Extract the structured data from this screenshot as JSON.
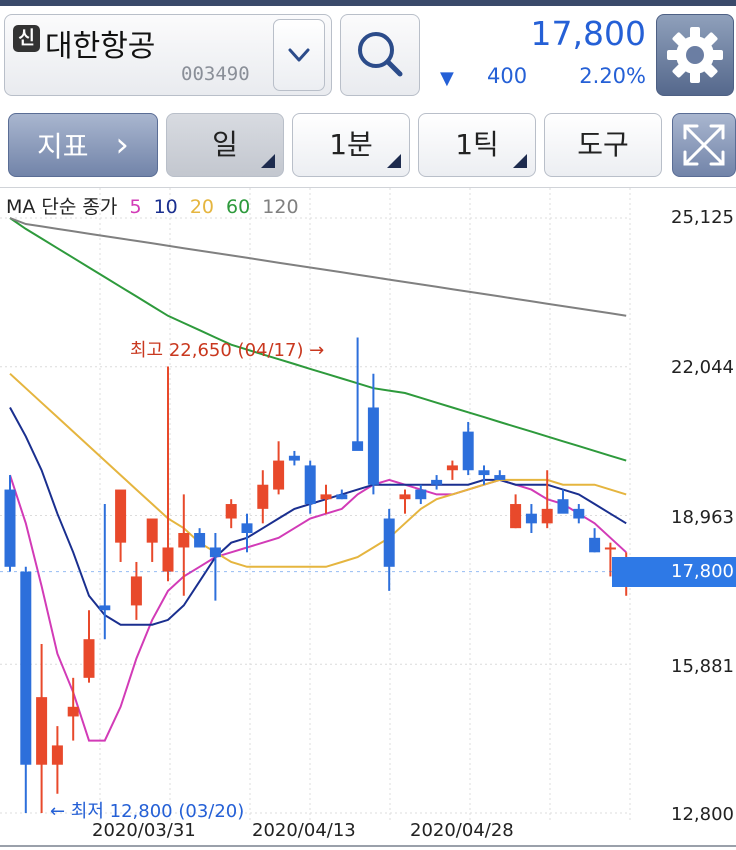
{
  "header": {
    "shin_badge": "신",
    "stock_name": "대한항공",
    "stock_code": "003490",
    "price": "17,800",
    "change_arrow": "▼",
    "change_value": "400",
    "change_pct": "2.20%"
  },
  "toolbar": {
    "indicator_label": "지표",
    "indicator_arrow": "›",
    "period_day": "일",
    "period_1min": "1분",
    "period_1tick": "1틱",
    "tools_label": "도구"
  },
  "legend": {
    "prefix": "MA 단순 종가",
    "ma": [
      {
        "label": "5",
        "color": "#d23bb7"
      },
      {
        "label": "10",
        "color": "#1a2f8f"
      },
      {
        "label": "20",
        "color": "#e5b53f"
      },
      {
        "label": "60",
        "color": "#2e9a3c"
      },
      {
        "label": "120",
        "color": "#808080"
      }
    ]
  },
  "price_axis": [
    "25,125",
    "22,044",
    "18,963",
    "15,881",
    "12,800"
  ],
  "current_tag": "17,800",
  "x_axis": [
    "2020/03/31",
    "2020/04/13",
    "2020/04/28"
  ],
  "annotations": {
    "high": "최고 22,650 (04/17) →",
    "low": "← 최저 12,800 (03/20)"
  },
  "colors": {
    "up": "#e8492b",
    "down": "#2d6fdb"
  },
  "chart_data": {
    "type": "candlestick",
    "ylim": [
      12800,
      25125
    ],
    "candles": [
      {
        "o": 19500,
        "h": 19800,
        "l": 17800,
        "c": 17900
      },
      {
        "o": 17800,
        "h": 17900,
        "l": 12800,
        "c": 13800
      },
      {
        "o": 13800,
        "h": 16300,
        "l": 12800,
        "c": 15200
      },
      {
        "o": 13800,
        "h": 14600,
        "l": 13200,
        "c": 14200
      },
      {
        "o": 14800,
        "h": 15600,
        "l": 14300,
        "c": 15000
      },
      {
        "o": 15600,
        "h": 17000,
        "l": 15500,
        "c": 16400
      },
      {
        "o": 17100,
        "h": 19200,
        "l": 16400,
        "c": 17000
      },
      {
        "o": 18400,
        "h": 19200,
        "l": 18000,
        "c": 19500
      },
      {
        "o": 17100,
        "h": 18000,
        "l": 16800,
        "c": 17700
      },
      {
        "o": 18400,
        "h": 18800,
        "l": 18000,
        "c": 18900
      },
      {
        "o": 17800,
        "h": 22050,
        "l": 17600,
        "c": 18300
      },
      {
        "o": 18300,
        "h": 19400,
        "l": 17300,
        "c": 18600
      },
      {
        "o": 18600,
        "h": 18700,
        "l": 18300,
        "c": 18300
      },
      {
        "o": 18300,
        "h": 18600,
        "l": 17200,
        "c": 18100
      },
      {
        "o": 18900,
        "h": 19300,
        "l": 18700,
        "c": 19200
      },
      {
        "o": 18800,
        "h": 19000,
        "l": 18200,
        "c": 18600
      },
      {
        "o": 19100,
        "h": 19900,
        "l": 18800,
        "c": 19600
      },
      {
        "o": 19500,
        "h": 20500,
        "l": 19400,
        "c": 20100
      },
      {
        "o": 20200,
        "h": 20300,
        "l": 20000,
        "c": 20100
      },
      {
        "o": 20000,
        "h": 20100,
        "l": 19000,
        "c": 19200
      },
      {
        "o": 19300,
        "h": 19600,
        "l": 19000,
        "c": 19400
      },
      {
        "o": 19400,
        "h": 19500,
        "l": 19300,
        "c": 19300
      },
      {
        "o": 20500,
        "h": 22650,
        "l": 20400,
        "c": 20300
      },
      {
        "o": 21200,
        "h": 21900,
        "l": 19400,
        "c": 19600
      },
      {
        "o": 18900,
        "h": 19100,
        "l": 17400,
        "c": 17900
      },
      {
        "o": 19300,
        "h": 19500,
        "l": 19000,
        "c": 19400
      },
      {
        "o": 19500,
        "h": 19600,
        "l": 19200,
        "c": 19300
      },
      {
        "o": 19700,
        "h": 19800,
        "l": 19500,
        "c": 19600
      },
      {
        "o": 19900,
        "h": 20100,
        "l": 19700,
        "c": 20000
      },
      {
        "o": 20700,
        "h": 20900,
        "l": 19800,
        "c": 19900
      },
      {
        "o": 19900,
        "h": 20000,
        "l": 19600,
        "c": 19800
      },
      {
        "o": 19800,
        "h": 19900,
        "l": 19700,
        "c": 19700
      },
      {
        "o": 18700,
        "h": 19400,
        "l": 18700,
        "c": 19200
      },
      {
        "o": 19000,
        "h": 19200,
        "l": 18600,
        "c": 18800
      },
      {
        "o": 18800,
        "h": 19900,
        "l": 18700,
        "c": 19100
      },
      {
        "o": 19300,
        "h": 19500,
        "l": 19100,
        "c": 19000
      },
      {
        "o": 19100,
        "h": 19200,
        "l": 18800,
        "c": 18900
      },
      {
        "o": 18500,
        "h": 18700,
        "l": 18200,
        "c": 18200
      },
      {
        "o": 18300,
        "h": 18400,
        "l": 17700,
        "c": 18300
      },
      {
        "o": 17600,
        "h": 18200,
        "l": 17300,
        "c": 17800
      }
    ],
    "ma_lines": [
      {
        "name": "5",
        "color": "#d23bb7",
        "values": [
          19800,
          18800,
          17500,
          16100,
          15300,
          14300,
          14300,
          15000,
          16000,
          16800,
          17400,
          17700,
          17900,
          18100,
          18200,
          18300,
          18400,
          18500,
          18700,
          18900,
          19000,
          19100,
          19400,
          19600,
          19700,
          19600,
          19500,
          19400,
          19400,
          19500,
          19600,
          19700,
          19600,
          19500,
          19300,
          19200,
          19000,
          18800,
          18500,
          18200
        ]
      },
      {
        "name": "10",
        "color": "#1a2f8f",
        "values": [
          21200,
          20600,
          19900,
          19000,
          18200,
          17300,
          16900,
          16700,
          16700,
          16700,
          16800,
          17100,
          17600,
          18100,
          18400,
          18500,
          18700,
          18900,
          19100,
          19200,
          19300,
          19400,
          19500,
          19600,
          19600,
          19600,
          19600,
          19600,
          19600,
          19600,
          19700,
          19700,
          19600,
          19600,
          19600,
          19500,
          19400,
          19200,
          19000,
          18800
        ]
      },
      {
        "name": "20",
        "color": "#e5b53f",
        "values": [
          21900,
          21600,
          21300,
          21000,
          20700,
          20400,
          20100,
          19800,
          19500,
          19200,
          18900,
          18700,
          18400,
          18200,
          18000,
          17900,
          17900,
          17900,
          17900,
          17900,
          17900,
          18000,
          18100,
          18300,
          18500,
          18800,
          19100,
          19300,
          19400,
          19500,
          19600,
          19700,
          19700,
          19700,
          19700,
          19600,
          19600,
          19600,
          19500,
          19400
        ]
      },
      {
        "name": "60",
        "color": "#2e9a3c",
        "values": [
          25125,
          24900,
          24700,
          24500,
          24300,
          24100,
          23900,
          23700,
          23500,
          23300,
          23100,
          22950,
          22800,
          22650,
          22500,
          22400,
          22300,
          22200,
          22100,
          22000,
          21900,
          21800,
          21700,
          21600,
          21550,
          21500,
          21400,
          21300,
          21200,
          21100,
          21000,
          20900,
          20800,
          20700,
          20600,
          20500,
          20400,
          20300,
          20200,
          20100
        ]
      },
      {
        "name": "120",
        "color": "#808080",
        "values": [
          25125,
          25000,
          24950,
          24900,
          24850,
          24800,
          24750,
          24700,
          24650,
          24600,
          24550,
          24500,
          24450,
          24400,
          24350,
          24300,
          24250,
          24200,
          24150,
          24100,
          24050,
          24000,
          23950,
          23900,
          23850,
          23800,
          23750,
          23700,
          23650,
          23600,
          23550,
          23500,
          23450,
          23400,
          23350,
          23300,
          23250,
          23200,
          23150,
          23100
        ]
      }
    ]
  }
}
